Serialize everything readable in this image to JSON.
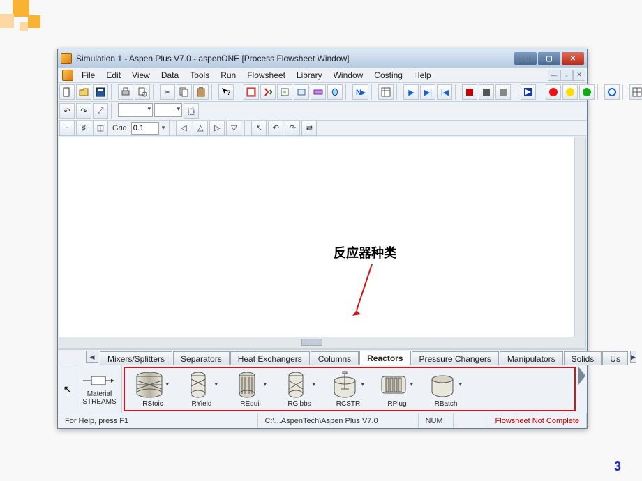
{
  "slide_number": "3",
  "window": {
    "title": "Simulation 1 - Aspen Plus V7.0 - aspenONE  [Process Flowsheet Window]"
  },
  "menu": {
    "items": [
      "File",
      "Edit",
      "View",
      "Data",
      "Tools",
      "Run",
      "Flowsheet",
      "Library",
      "Window",
      "Costing",
      "Help"
    ]
  },
  "toolbar": {
    "icons_row1": [
      "new",
      "open",
      "save",
      "print",
      "preview",
      "cut",
      "copy",
      "paste",
      "help-cursor",
      "data-browser",
      "toggle",
      "tool-a",
      "tool-b",
      "tool-c",
      "tool-d",
      "next",
      "grid",
      "play",
      "step",
      "rewind",
      "stop-a",
      "stop-b",
      "stop-c",
      "flag",
      "traffic-red",
      "traffic-yellow",
      "traffic-green",
      "ring",
      "table"
    ],
    "icons_row2": [
      "t2a",
      "t2b",
      "t2c",
      "t2d",
      "t2e",
      "t2f"
    ]
  },
  "grid": {
    "label": "Grid",
    "value": "0.1"
  },
  "annotation": "反应器种类",
  "model_library": {
    "tabs": [
      "Mixers/Splitters",
      "Separators",
      "Heat Exchangers",
      "Columns",
      "Reactors",
      "Pressure Changers",
      "Manipulators",
      "Solids",
      "Us"
    ],
    "active": "Reactors",
    "streams": {
      "line1": "Material",
      "line2": "STREAMS"
    },
    "reactors": [
      "RStoic",
      "RYield",
      "REquil",
      "RGibbs",
      "RCSTR",
      "RPlug",
      "RBatch"
    ]
  },
  "status": {
    "help": "For Help, press F1",
    "path": "C:\\...AspenTech\\Aspen Plus V7.0",
    "num": "NUM",
    "warn": "Flowsheet Not Complete"
  }
}
